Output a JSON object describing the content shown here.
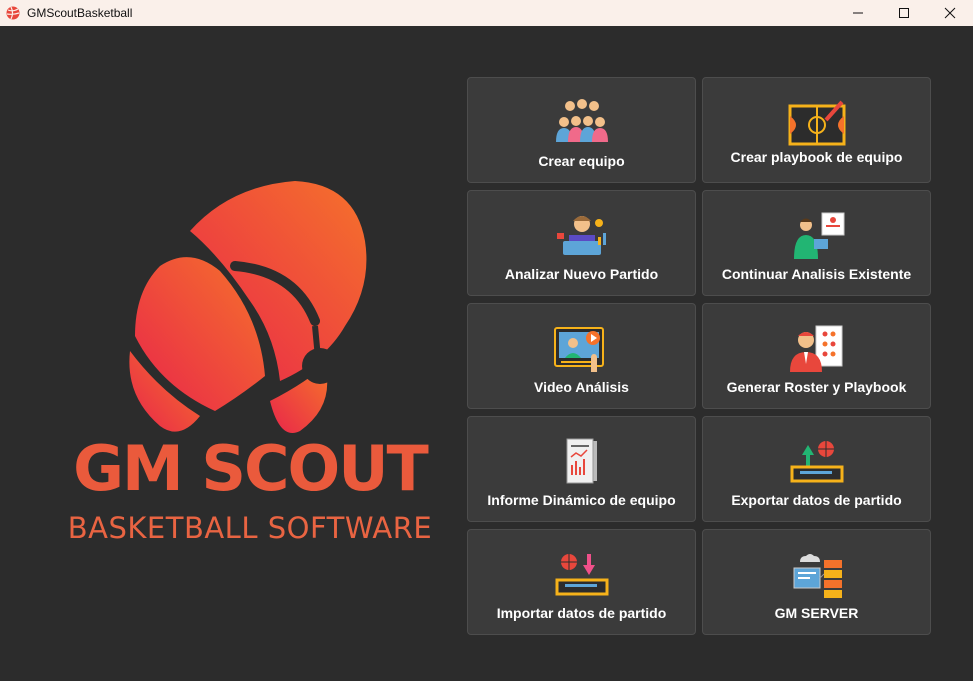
{
  "window": {
    "title": "GMScoutBasketball"
  },
  "logo": {
    "title": "GM SCOUT",
    "subtitle": "BASKETBALL SOFTWARE"
  },
  "menu": [
    {
      "label": "Crear equipo",
      "icon": "team-icon"
    },
    {
      "label": "Crear playbook de equipo",
      "icon": "playbook-court-icon"
    },
    {
      "label": "Analizar Nuevo Partido",
      "icon": "analyst-icon"
    },
    {
      "label": "Continuar Analisis Existente",
      "icon": "presentation-icon"
    },
    {
      "label": "Video Análisis",
      "icon": "video-icon"
    },
    {
      "label": "Generar Roster y Playbook",
      "icon": "roster-icon"
    },
    {
      "label": "Informe Dinámico de equipo",
      "icon": "report-icon"
    },
    {
      "label": "Exportar datos de partido",
      "icon": "export-icon"
    },
    {
      "label": "Importar datos de partido",
      "icon": "import-icon"
    },
    {
      "label": "GM SERVER",
      "icon": "server-icon"
    }
  ]
}
